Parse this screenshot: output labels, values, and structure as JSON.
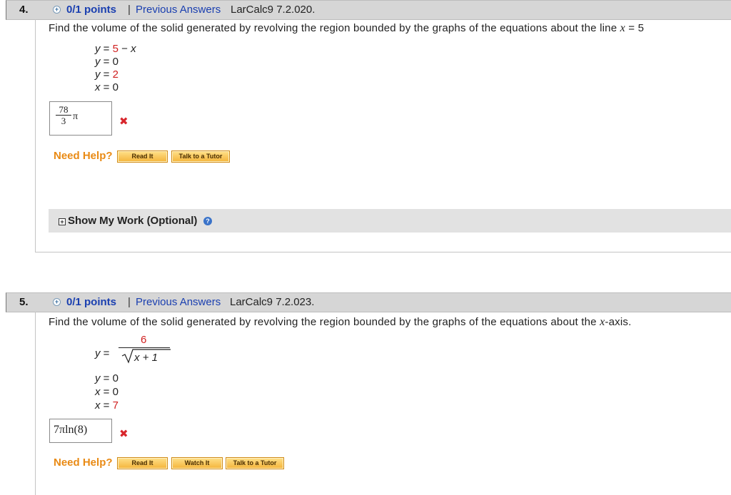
{
  "problems": [
    {
      "number": "4.",
      "points": "0/1 points",
      "separator": "|",
      "previous_answers": "Previous Answers",
      "source": "LarCalc9 7.2.020.",
      "question_prefix": "Find the volume of the solid generated by revolving the region bounded by the graphs of the equations about the line",
      "question_var": "x",
      "question_suffix": "= 5",
      "equations": [
        {
          "var": "y",
          "eq": "=",
          "rhs_red": "5",
          "rhs_rest": " − ",
          "rhs_var": "x"
        },
        {
          "var": "y",
          "eq": "=",
          "rhs": "0"
        },
        {
          "var": "y",
          "eq": "=",
          "rhs_red": "2"
        },
        {
          "var": "x",
          "eq": "=",
          "rhs": "0"
        }
      ],
      "answer": {
        "numerator": "78",
        "denominator": "3",
        "suffix": "π"
      },
      "need_help": "Need Help?",
      "buttons": [
        "Read It",
        "Talk to a Tutor"
      ],
      "show_my_work": "Show My Work (Optional)"
    },
    {
      "number": "5.",
      "points": "0/1 points",
      "separator": "|",
      "previous_answers": "Previous Answers",
      "source": "LarCalc9 7.2.023.",
      "question_prefix": "Find the volume of the solid generated by revolving the region bounded by the graphs of the equations about the",
      "question_var": "x",
      "question_suffix": "-axis.",
      "equations": [
        {
          "var": "y",
          "eq": "=",
          "numerator": "6",
          "radicand": "x + 1"
        },
        {
          "var": "y",
          "eq": "=",
          "rhs": "0"
        },
        {
          "var": "x",
          "eq": "=",
          "rhs": "0"
        },
        {
          "var": "x",
          "eq": "=",
          "rhs_red": "7"
        }
      ],
      "answer": {
        "text": "7πln(8)"
      },
      "need_help": "Need Help?",
      "buttons": [
        "Read It",
        "Watch It",
        "Talk to a Tutor"
      ]
    }
  ],
  "colors": {
    "link": "#1a3fb0",
    "highlight": "#d02020",
    "help": "#e98a14",
    "wrong": "#d8262c"
  },
  "icons": {
    "plus": "+",
    "wrong": "✖",
    "expand": "+",
    "help": "?"
  }
}
